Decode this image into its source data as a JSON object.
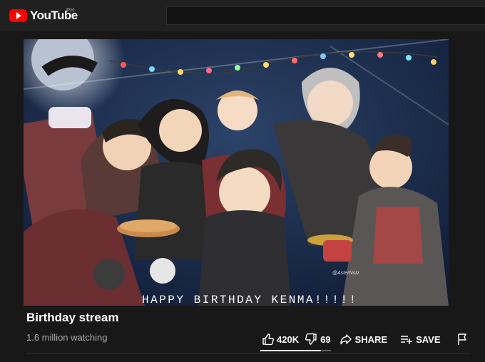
{
  "header": {
    "logo_text": "YouTube",
    "region_code": "PH"
  },
  "video": {
    "overlay_text": "HAPPY BIRTHDAY KENMA!!!!!",
    "signature": "@AsterNotz",
    "title": "Birthday stream",
    "views_text": "1.6 million watching"
  },
  "actions": {
    "like_count": "420K",
    "dislike_count": "69",
    "share_label": "SHARE",
    "save_label": "SAVE",
    "like_ratio": 0.86
  },
  "colors": {
    "brand_red": "#ff0000",
    "background": "#181818",
    "header": "#202020",
    "secondary_text": "#aaaaaa"
  },
  "icons": [
    "youtube-logo-icon",
    "thumbs-up-icon",
    "thumbs-down-icon",
    "share-icon",
    "save-playlist-icon",
    "flag-icon"
  ]
}
